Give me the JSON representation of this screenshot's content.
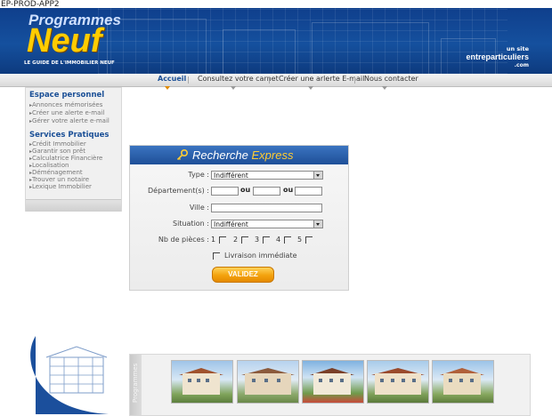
{
  "server_label": "EP-PROD-APP2",
  "header": {
    "logo_top": "Programmes",
    "logo_main": "Neuf",
    "logo_tagline": "LE GUIDE DE L'IMMOBILIER NEUF",
    "site_by": "un site",
    "site_name": "entreparticuliers",
    "site_tld": ".com"
  },
  "nav": {
    "items": [
      {
        "label": "Accueil",
        "active": true
      },
      {
        "label": "Consultez votre carnet",
        "active": false
      },
      {
        "label": "Créer une arlerte E-mail",
        "active": false
      },
      {
        "label": "Nous contacter",
        "active": false
      }
    ]
  },
  "sidebar": {
    "espace_title": "Espace personnel",
    "espace_items": [
      "Annonces mémorisées",
      "Créer une alerte e-mail",
      "Gérer votre alerte e-mail"
    ],
    "services_title": "Services Pratiques",
    "services_items": [
      "Crédit Immobilier",
      "Garantir son prêt",
      "Calculatrice Financière",
      "Localisation",
      "Déménagement",
      "Trouver un notaire",
      "Lexique Immobilier"
    ]
  },
  "search": {
    "title_part1": "Recherche ",
    "title_part2": "Express",
    "type_label": "Type :",
    "type_value": "Indifférent",
    "departement_label": "Département(s) :",
    "ou": "ou",
    "ville_label": "Ville :",
    "situation_label": "Situation :",
    "situation_value": "Indifférent",
    "pieces_label": "Nb de pièces :",
    "pieces": [
      "1",
      "2",
      "3",
      "4",
      "5"
    ],
    "livraison_label": "Livraison immédiate",
    "submit_label": "VALIDEZ"
  },
  "gallery": {
    "side_label": "Programmes",
    "thumbs": [
      "programme-1",
      "programme-2",
      "programme-3",
      "programme-4",
      "programme-5"
    ]
  },
  "colors": {
    "header_blue": "#15509e",
    "accent_orange": "#f3a20e",
    "link_blue": "#1a4f96"
  }
}
